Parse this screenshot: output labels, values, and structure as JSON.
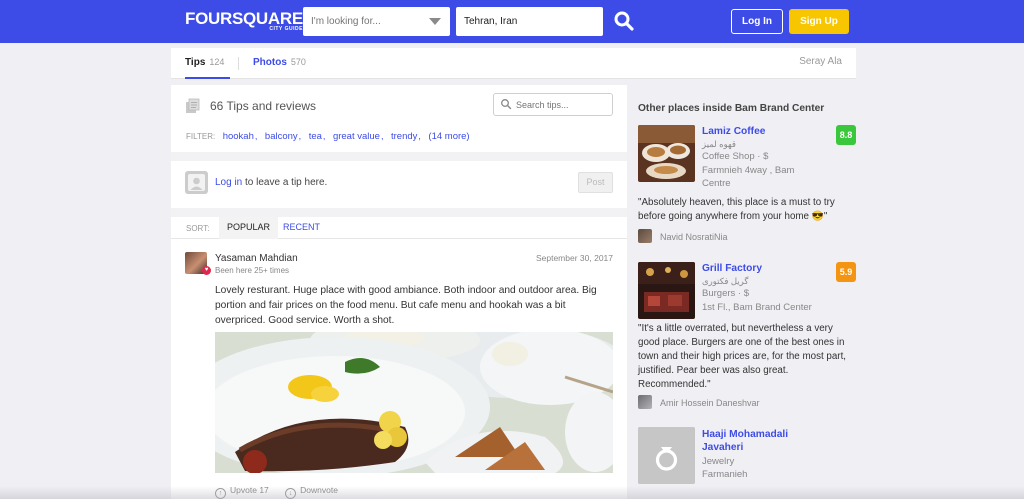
{
  "header": {
    "logo_main": "FOURSQUARE",
    "logo_sub": "CITY GUIDE",
    "search_placeholder": "I'm looking for...",
    "location_value": "Tehran, Iran",
    "login_label": "Log In",
    "signup_label": "Sign Up"
  },
  "tabs": {
    "tips_label": "Tips",
    "tips_count": "124",
    "photos_label": "Photos",
    "photos_count": "570",
    "user_name": "Seray Ala"
  },
  "tips": {
    "title": "66 Tips and reviews",
    "search_placeholder": "Search tips...",
    "filter_label": "FILTER:",
    "filters": [
      "hookah",
      "balcony",
      "tea",
      "great value",
      "trendy"
    ],
    "filter_more": "(14 more)",
    "login_link": "Log in",
    "login_rest": " to leave a tip here.",
    "post_label": "Post",
    "sort_label": "SORT:",
    "sort_popular": "POPULAR",
    "sort_recent": "RECENT"
  },
  "tip": {
    "author": "Yasaman Mahdian",
    "been_here": "Been here 25+ times",
    "date": "September 30, 2017",
    "text": "Lovely resturant. Huge place with good ambiance. Both indoor and outdoor area. Big portion and fair prices on the food menu. But cafe menu and hookah was a bit overpriced. Good service. Worth a shot.",
    "upvote_label": "Upvote",
    "upvote_count": "17",
    "downvote_label": "Downvote"
  },
  "side": {
    "title": "Other places inside Bam Brand Center",
    "venues": [
      {
        "name": "Lamiz Coffee",
        "native_name": "قهوه لمیز",
        "category": "Coffee Shop · $",
        "address": "Farmnieh 4way , Bam Centre",
        "score": "8.8",
        "score_color": "#3bc73b",
        "quote": "\"Absolutely heaven, this place is a must to try before going anywhere from your home 😎\"",
        "quote_author": "Navid NosratiNia"
      },
      {
        "name": "Grill Factory",
        "native_name": "گریل فکتوری",
        "category": "Burgers · $",
        "address": "1st Fl., Bam Brand Center",
        "score": "5.9",
        "score_color": "#f39512",
        "quote": "\"It's a little overrated, but nevertheless a very good place. Burgers are one of the best ones in town and their high prices are, for the most part, justified. Pear beer was also great. Recommended.\"",
        "quote_author": "Amir Hossein Daneshvar"
      },
      {
        "name": "Haaji Mohamadali Javaheri",
        "category": "Jewelry",
        "address": "Farmanieh",
        "icon": "ring-icon"
      }
    ]
  },
  "colors": {
    "brand": "#3d4ce6",
    "signup": "#f7c600",
    "link": "#3d4ce6"
  }
}
